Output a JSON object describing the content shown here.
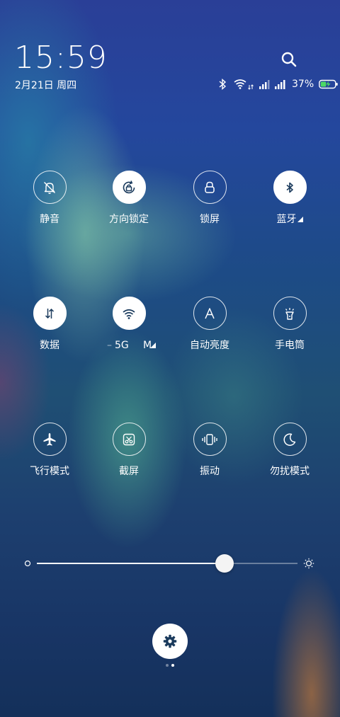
{
  "status": {
    "time": "15:59",
    "date": "2月21日 周四",
    "battery_percent": "37%",
    "icons": [
      "bluetooth-icon",
      "wifi-icon",
      "signal-icon",
      "signal-icon",
      "battery-charging-icon"
    ]
  },
  "tiles": [
    {
      "label": "静音",
      "icon": "bell-off-icon",
      "on": false
    },
    {
      "label": "方向锁定",
      "icon": "rotation-lock-icon",
      "on": true
    },
    {
      "label": "锁屏",
      "icon": "lock-icon",
      "on": false
    },
    {
      "label": "蓝牙",
      "icon": "bluetooth-icon",
      "on": true,
      "has_more": true
    },
    {
      "label": "数据",
      "icon": "data-arrows-icon",
      "on": true
    },
    {
      "label": "5G",
      "label_prefix": "–",
      "label_suffix": "M",
      "icon": "wifi-icon",
      "on": true,
      "has_more": true
    },
    {
      "label": "自动亮度",
      "icon": "auto-brightness-icon",
      "on": false
    },
    {
      "label": "手电筒",
      "icon": "flashlight-icon",
      "on": false
    },
    {
      "label": "飞行模式",
      "icon": "airplane-icon",
      "on": false
    },
    {
      "label": "截屏",
      "icon": "screenshot-icon",
      "on": false
    },
    {
      "label": "振动",
      "icon": "vibrate-icon",
      "on": false
    },
    {
      "label": "勿扰模式",
      "icon": "moon-icon",
      "on": false
    }
  ],
  "brightness": {
    "level": 0.72
  },
  "pager": {
    "count": 2,
    "active": 1
  },
  "colors": {
    "accent": "#1a3a5c",
    "tile_on_bg": "#ffffff"
  }
}
